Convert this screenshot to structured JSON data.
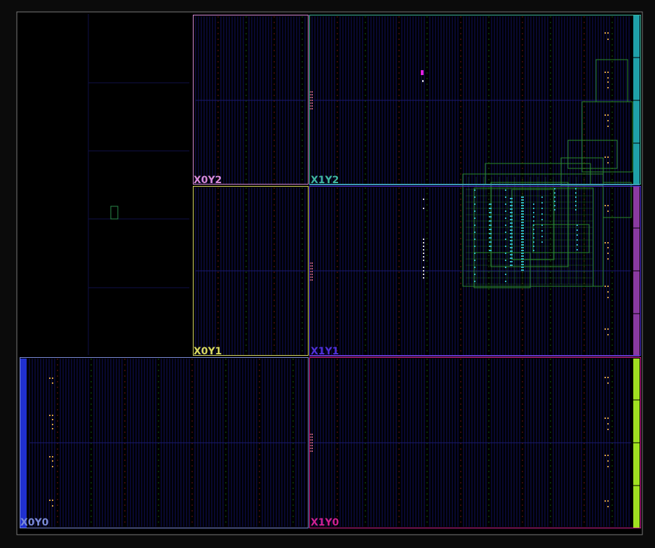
{
  "view": {
    "background": "#000000",
    "frame_color": "#7a7a7a"
  },
  "regions": [
    {
      "id": "X0Y2",
      "label": "X0Y2",
      "color": "#d68ad8"
    },
    {
      "id": "X1Y2",
      "label": "X1Y2",
      "color": "#3fb7a0"
    },
    {
      "id": "X0Y1",
      "label": "X0Y1",
      "color": "#d8d860"
    },
    {
      "id": "X1Y1",
      "label": "X1Y1",
      "color": "#5030d8"
    },
    {
      "id": "X0Y0",
      "label": "X0Y0",
      "color": "#7a8ad8"
    },
    {
      "id": "X1Y0",
      "label": "X1Y0",
      "color": "#d02090"
    }
  ],
  "colors": {
    "routing": "#2a8a2a",
    "cells": "#2fb7c7",
    "io_markers": "#d8a040",
    "highlight": "#e020e0",
    "column_blue": "#101060",
    "column_red": "#6a1818",
    "column_green": "#145a14",
    "edge_teal": "#1fa0a8",
    "edge_purple": "#8a3aa0",
    "edge_lime": "#a0e020",
    "edge_blue": "#2030d0"
  }
}
